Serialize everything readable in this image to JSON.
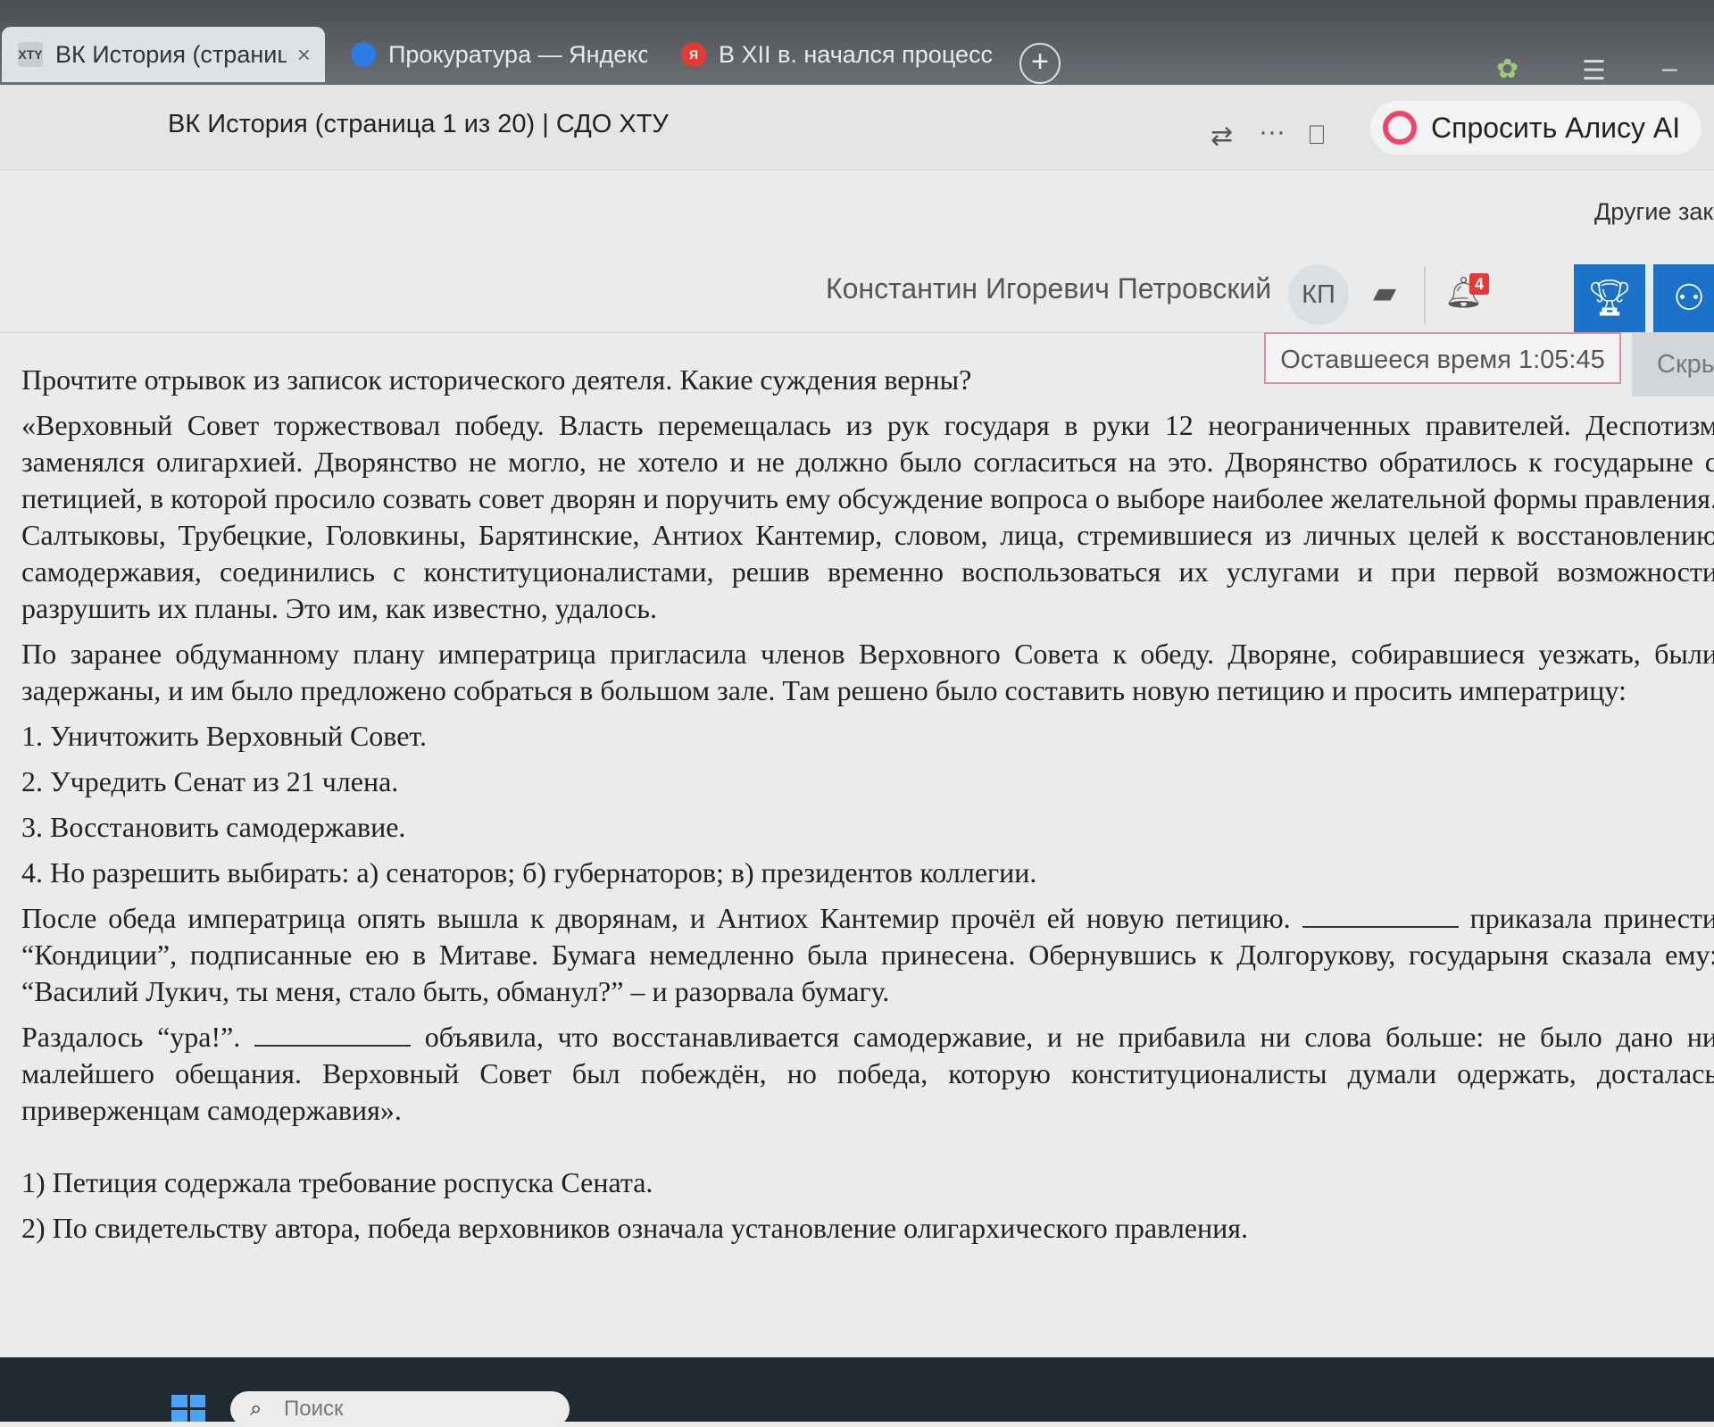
{
  "tabs": [
    {
      "favicon": "XTY",
      "label": "ВК История (страница",
      "close": "×"
    },
    {
      "favicon": "",
      "label": "Прокуратура — Яндекс Д"
    },
    {
      "favicon": "Я",
      "label": "В XII в. начался процесс п"
    }
  ],
  "new_tab": "+",
  "address": {
    "page_title": "ВК История (страница 1 из 20) | СДО ХТУ",
    "more": "···",
    "alice_label": "Спросить Алису AI"
  },
  "other_label": "Другие зак",
  "user": {
    "name": "Константин Игоревич Петровский",
    "initials": "КП",
    "notifications_count": "4"
  },
  "timer": "Оставшееся время 1:05:45",
  "hide_label": "Скрыть",
  "question": {
    "prompt": "Прочтите отрывок из записок исторического деятеля. Какие суждения верны?",
    "para1": "«Верховный Совет торжествовал победу. Власть перемещалась из рук государя в руки 12 неограниченных правителей. Деспотизм заменялся олигархией. Дворянство не могло, не хотело и не должно было согласиться на это. Дворянство обратилось к государыне с петицией, в которой просило созвать совет дворян и поручить ему обсуждение вопроса о выборе наиболее желательной формы правления. Салтыковы, Трубецкие, Головкины, Барятинские, Антиох Кантемир, словом, лица, стремившиеся из личных целей к восстановлению самодержавия, соединились с конституционалистами, решив временно воспользоваться их услугами и при первой возможности разрушить их планы. Это им, как известно, удалось.",
    "para2": "По заранее обдуманному плану императрица пригласила членов Верховного Совета к обеду. Дворяне, собиравшиеся уезжать, были задержаны, и им было предложено собраться в большом зале. Там решено было составить новую петицию и просить императрицу:",
    "items": [
      "1. Уничтожить Верховный Совет.",
      "2. Учредить Сенат из 21 члена.",
      "3. Восстановить самодержавие.",
      "4. Но разрешить выбирать: а) сенаторов; б) губернаторов; в) президентов коллегии."
    ],
    "para3_a": "После обеда императрица опять вышла к дворянам, и Антиох Кантемир прочёл ей новую петицию.",
    "para3_b": "приказала принести “Кондиции”, подписанные ею в Митаве. Бумага немедленно была принесена. Обернувшись к Долгорукову, государыня сказала ему: “Василий Лукич, ты меня, стало быть, обманул?” – и разорвала бумагу.",
    "para4_a": "Раздалось “ура!”.",
    "para4_b": "объявила, что восстанавливается самодержавие, и не прибавила ни слова больше: не было дано ни малейшего обещания. Верховный Совет был побеждён, но победа, которую конституционалисты думали одержать, досталась приверженцам самодержавия»."
  },
  "answers": [
    "1) Петиция содержала требование роспуска Сената.",
    "2) По свидетельству автора, победа верховников означала установление олигархического правления."
  ],
  "taskbar": {
    "search_placeholder": "Поиск"
  }
}
